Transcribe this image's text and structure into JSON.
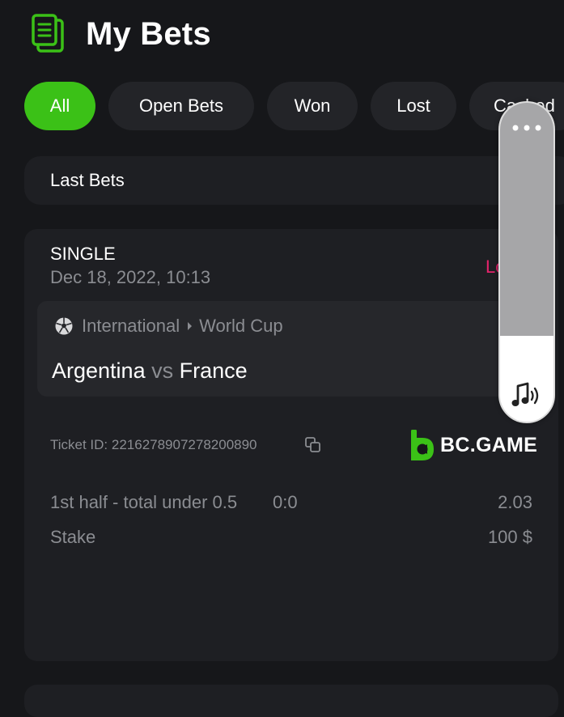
{
  "header": {
    "title": "My Bets",
    "icon": "bets-document-icon"
  },
  "filters": {
    "items": [
      {
        "label": "All",
        "active": true
      },
      {
        "label": "Open Bets",
        "active": false
      },
      {
        "label": "Won",
        "active": false
      },
      {
        "label": "Lost",
        "active": false
      },
      {
        "label": "Cashed",
        "active": false
      }
    ]
  },
  "dropdown": {
    "label": "Last Bets"
  },
  "bet": {
    "type": "SINGLE",
    "date": "Dec 18, 2022, 10:13",
    "status": "Lost",
    "league": {
      "category": "International",
      "competition": "World Cup",
      "icon": "soccer-ball-icon"
    },
    "teams": {
      "home": "Argentina",
      "vs": "vs",
      "away": "France"
    },
    "ticket": "Ticket ID: 2216278907278200890",
    "brand": "BC.GAME",
    "selection": {
      "label": "1st half - total under 0.5",
      "score": "0:0",
      "odds": "2.03"
    },
    "stake": {
      "label": "Stake",
      "value": "100 $"
    }
  },
  "volume_overlay": {
    "level": 0.27
  },
  "colors": {
    "background": "#16171a",
    "card": "#1e1f23",
    "accent_green": "#3bc117",
    "lost_pink": "#e6236c",
    "muted_text": "#8b8d92"
  }
}
